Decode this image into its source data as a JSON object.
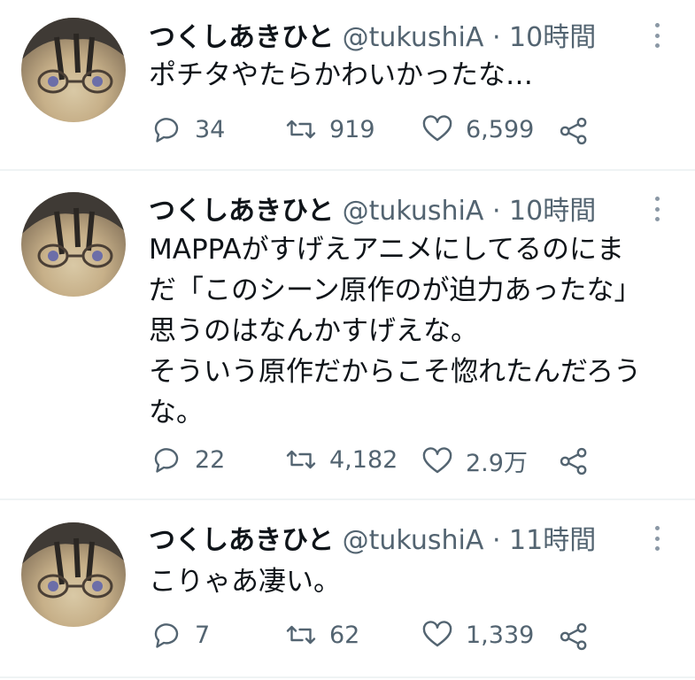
{
  "tweets": [
    {
      "name": "つくしあきひと",
      "handle": "@tukushiA",
      "separator": "·",
      "time": "10時間",
      "text": "ポチタやたらかわいかったな…",
      "replies": "34",
      "retweets": "919",
      "likes": "6,599"
    },
    {
      "name": "つくしあきひと",
      "handle": "@tukushiA",
      "separator": "·",
      "time": "10時間",
      "text": "MAPPAがすげえアニメにしてるのにま\nだ「このシーン原作のが迫力あったな」\n思うのはなんかすげえな。\nそういう原作だからこそ惚れたんだろう\nな。",
      "replies": "22",
      "retweets": "4,182",
      "likes": "2.9万"
    },
    {
      "name": "つくしあきひと",
      "handle": "@tukushiA",
      "separator": "·",
      "time": "11時間",
      "text": "こりゃあ凄い。",
      "replies": "7",
      "retweets": "62",
      "likes": "1,339"
    }
  ],
  "icons": {
    "reply": "reply-icon",
    "retweet": "retweet-icon",
    "like": "heart-icon",
    "share": "share-icon",
    "more": "more-dots-icon"
  },
  "colors": {
    "text_primary": "#0f1419",
    "text_secondary": "#536471",
    "divider": "#eff3f4"
  }
}
